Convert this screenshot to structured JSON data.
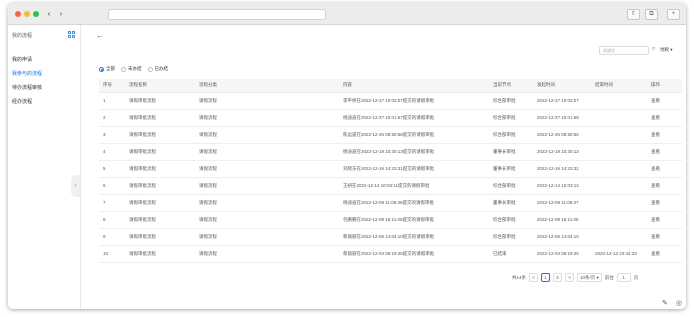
{
  "titlebar": {
    "back": "‹",
    "forward": "›",
    "icons": [
      "share-icon",
      "tabs-icon",
      "new-tab-icon"
    ],
    "share_glyph": "⇧",
    "tabs_glyph": "⧉",
    "new_glyph": "+"
  },
  "sidebar": {
    "header": "我的流程",
    "grid_icon": "grid-icon",
    "items": [
      {
        "label": "我的申请",
        "active": false
      },
      {
        "label": "我参与的流程",
        "active": true
      },
      {
        "label": "待办流程审核",
        "active": false
      },
      {
        "label": "经办流程",
        "active": false
      }
    ],
    "collapse_glyph": "‹"
  },
  "main": {
    "back_glyph": "←",
    "search_placeholder": "关键字",
    "search_glyph": "⌕",
    "org_select": "地税 ▾",
    "filters": [
      {
        "label": "全部",
        "checked": true
      },
      {
        "label": "未办结",
        "checked": false
      },
      {
        "label": "已办结",
        "checked": false
      }
    ],
    "columns": [
      "序号",
      "流程名称",
      "流程分类",
      "内容",
      "当前节点",
      "发起时间",
      "结束时间",
      "操作"
    ],
    "rows": [
      {
        "no": "1",
        "name": "请假审批流程",
        "category": "请假流程",
        "content": "李平桥在2022-12-27 10:02:07提交的请假审批",
        "node": "综合部审批",
        "start": "2022-12-27 10:02:07",
        "end": "",
        "op": "查看"
      },
      {
        "no": "2",
        "name": "请假审批流程",
        "category": "请假流程",
        "content": "杨迪迪在2022-12-27 10:01:57提交的请假审批",
        "node": "综合部审批",
        "start": "2022-12-27 10:01:58",
        "end": "",
        "op": "查看"
      },
      {
        "no": "3",
        "name": "请假审批流程",
        "category": "请假流程",
        "content": "陈远遥在2022-12-26 08:50:56提交的请假审批",
        "node": "综合部审批",
        "start": "2022-12-26 08:50:56",
        "end": "",
        "op": "查看"
      },
      {
        "no": "4",
        "name": "请假审批流程",
        "category": "请假流程",
        "content": "杨迪迪在2022-12-19 10:30:13提交的请假审批",
        "node": "董事长审批",
        "start": "2022-12-19 10:30:13",
        "end": "",
        "op": "查看"
      },
      {
        "no": "5",
        "name": "请假审批流程",
        "category": "请假流程",
        "content": "刘晓东在2022-12-16 14:23:31提交的请假审批",
        "node": "董事长审批",
        "start": "2022-12-16 14:23:32",
        "end": "",
        "op": "查看"
      },
      {
        "no": "6",
        "name": "请假审批流程",
        "category": "请假流程",
        "content": "王妍在2022-12-14 10:03:11提交的请假审批",
        "node": "综合部审批",
        "start": "2022-12-14 10:03:12",
        "end": "",
        "op": "查看"
      },
      {
        "no": "7",
        "name": "请假审批流程",
        "category": "请假流程",
        "content": "杨迪迪在2022-12-09 11:06:36提交的请假审批",
        "node": "董事长审批",
        "start": "2022-12-09 11:06:37",
        "end": "",
        "op": "查看"
      },
      {
        "no": "8",
        "name": "请假审批流程",
        "category": "请假流程",
        "content": "包鹏鹏在2022-12-08 16:11:06提交的请假审批",
        "node": "综合部审批",
        "start": "2022-12-08 16:11:06",
        "end": "",
        "op": "查看"
      },
      {
        "no": "9",
        "name": "请假审批流程",
        "category": "请假流程",
        "content": "蔡丽丽在2022-12-06 14:04:10提交的请假审批",
        "node": "综合部审批",
        "start": "2022-12-06 14:04:10",
        "end": "",
        "op": "查看"
      },
      {
        "no": "10",
        "name": "请假审批流程",
        "category": "请假流程",
        "content": "蔡丽丽在2022-12-04 09:19:25提交的请假审批",
        "node": "已结束",
        "start": "2022-12-04 09:19:25",
        "end": "2022-12-13 23:44:33",
        "op": "查看"
      }
    ],
    "pagination": {
      "total": "共14条",
      "prev": "<",
      "pages": [
        "1",
        "2"
      ],
      "current": "1",
      "next": ">",
      "page_size": "10条/页 ▾",
      "goto_label": "前往",
      "goto_value": "1",
      "goto_suffix": "页"
    },
    "bottom_icons": [
      {
        "name": "edit-icon",
        "glyph": "✎"
      },
      {
        "name": "target-icon",
        "glyph": "◎"
      },
      {
        "name": "delete-icon",
        "glyph": "🗑"
      },
      {
        "name": "volume-icon",
        "glyph": "🔈"
      },
      {
        "name": "copy-icon",
        "glyph": "⧉"
      },
      {
        "name": "zoom-icon",
        "glyph": "⌕"
      }
    ]
  },
  "colors": {
    "accent": "#1a73e8",
    "link": "#1a73e8"
  }
}
